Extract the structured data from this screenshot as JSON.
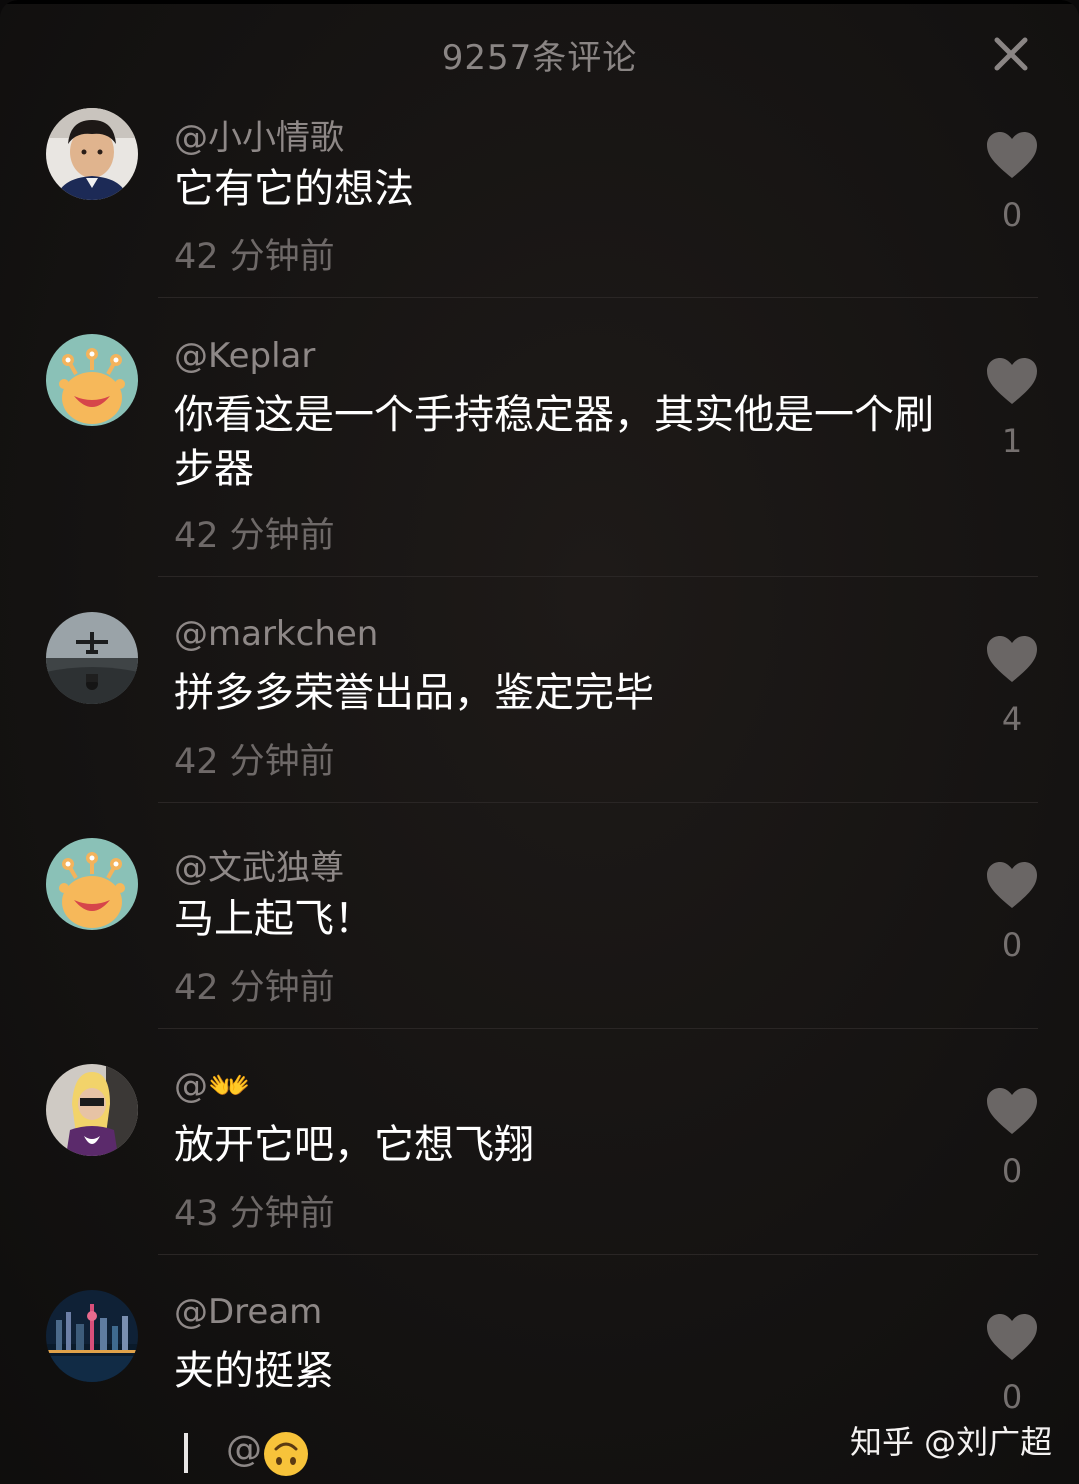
{
  "header": {
    "title": "9257条评论"
  },
  "comments": [
    {
      "username": "@小小情歌",
      "text": "它有它的想法",
      "time": "42 分钟前",
      "likes": "0",
      "avatar": "photo-boy"
    },
    {
      "username": "@Keplar",
      "text": "你看这是一个手持稳定器，其实他是一个刷步器",
      "time": "42 分钟前",
      "likes": "1",
      "avatar": "monster-cartoon"
    },
    {
      "username": "@markchen",
      "text": "拼多多荣誉出品，鉴定完毕",
      "time": "42 分钟前",
      "likes": "4",
      "avatar": "airplane-road"
    },
    {
      "username": "@文武独尊",
      "text": "马上起飞！",
      "time": "42 分钟前",
      "likes": "0",
      "avatar": "monster-cartoon"
    },
    {
      "username": "@👐",
      "text": "放开它吧，它想飞翔",
      "time": "43 分钟前",
      "likes": "0",
      "avatar": "cartoon-character"
    },
    {
      "username": "@Dream",
      "text": "夹的挺紧",
      "time": "",
      "likes": "0",
      "avatar": "city-night"
    }
  ],
  "input": {
    "at_label": "@",
    "emoji_icon": "upside-down-face-icon"
  },
  "watermark": "知乎 @刘广超",
  "colors": {
    "background": "#151312",
    "username": "#8e8887",
    "text": "#ffffff",
    "time": "#6e6968",
    "heart": "#6a6665"
  }
}
